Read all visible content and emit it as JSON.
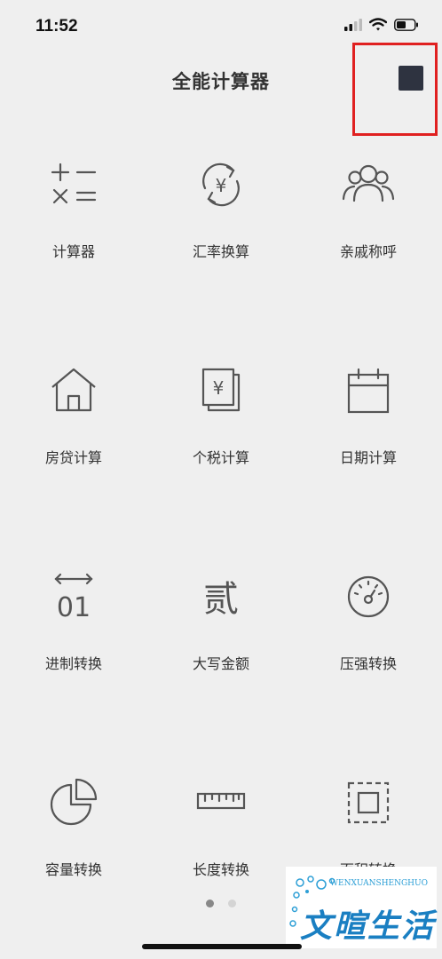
{
  "status": {
    "time": "11:52"
  },
  "header": {
    "title": "全能计算器"
  },
  "tools": [
    {
      "label": "计算器",
      "icon": "calculator-icon"
    },
    {
      "label": "汇率换算",
      "icon": "currency-exchange-icon"
    },
    {
      "label": "亲戚称呼",
      "icon": "relatives-icon"
    },
    {
      "label": "房贷计算",
      "icon": "house-icon"
    },
    {
      "label": "个税计算",
      "icon": "tax-document-icon"
    },
    {
      "label": "日期计算",
      "icon": "calendar-icon"
    },
    {
      "label": "进制转换",
      "icon": "binary-icon"
    },
    {
      "label": "大写金额",
      "icon": "chinese-numeral-icon"
    },
    {
      "label": "压强转换",
      "icon": "pressure-gauge-icon"
    },
    {
      "label": "容量转换",
      "icon": "pie-chart-icon"
    },
    {
      "label": "长度转换",
      "icon": "ruler-icon"
    },
    {
      "label": "面积转换",
      "icon": "area-icon"
    }
  ],
  "icon_glyphs": {
    "yuan": "¥",
    "two": "贰",
    "binary": "01"
  },
  "pager": {
    "total": 2,
    "active": 0
  },
  "watermark": {
    "small": "WENXUANSHENGHUO",
    "big": "文暄生活"
  },
  "colors": {
    "background": "#efefef",
    "icon_stroke": "#555555",
    "highlight": "#e02020",
    "stop_button": "#2e3340"
  }
}
